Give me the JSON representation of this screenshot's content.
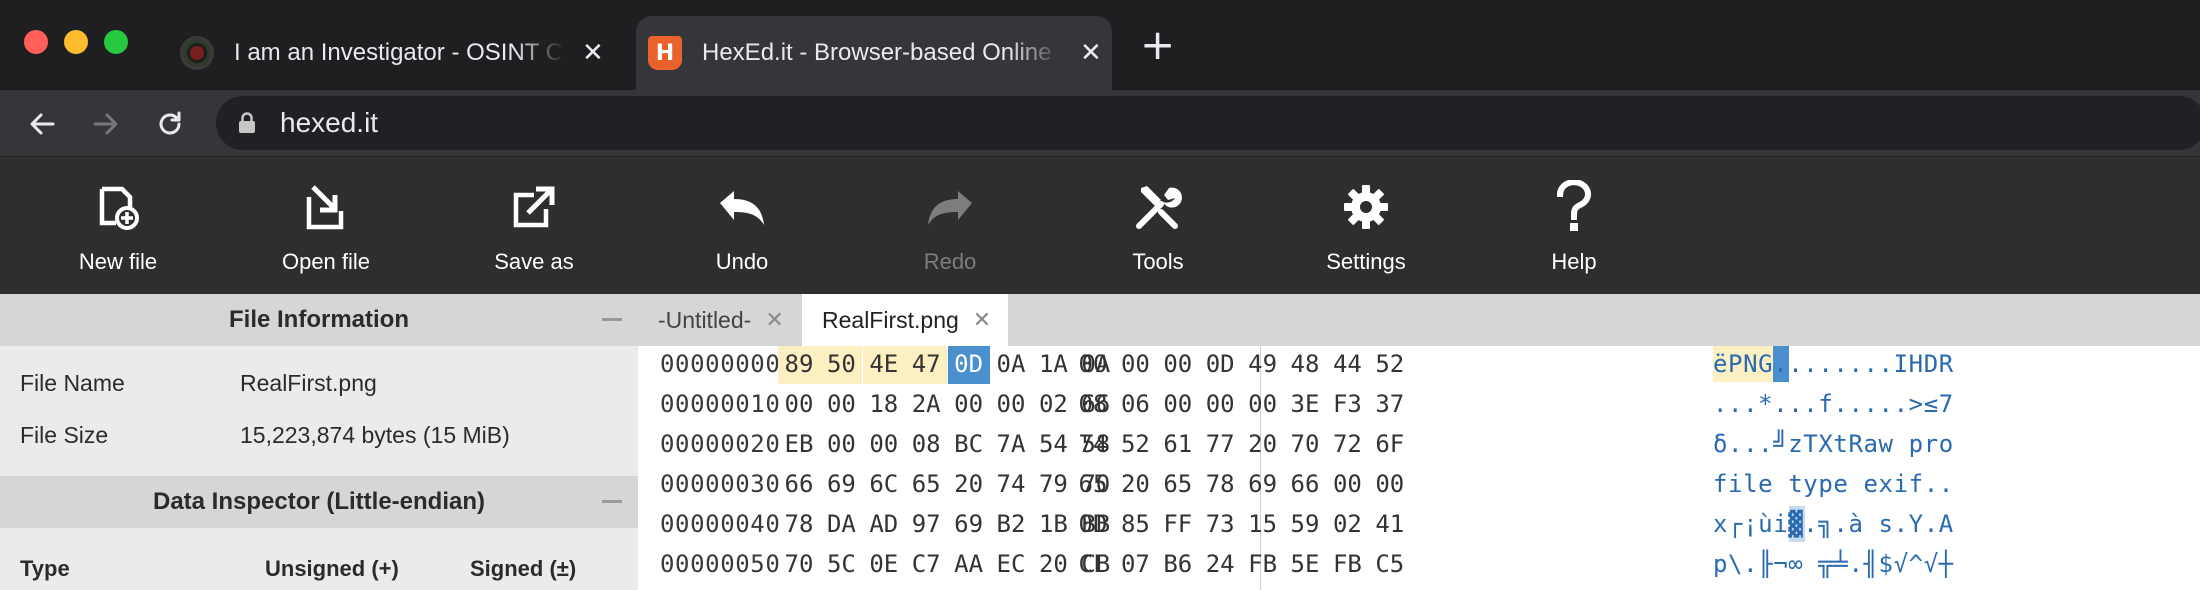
{
  "browser": {
    "tabs": [
      {
        "title": "I am an Investigator - OSINT Ch",
        "active": false
      },
      {
        "title": "HexEd.it - Browser-based Online",
        "active": true
      }
    ],
    "close_glyph": "✕",
    "new_tab_glyph": "+",
    "url": "hexed.it"
  },
  "toolbar": {
    "items": [
      {
        "label": "New file",
        "icon": "new-file-icon",
        "enabled": true
      },
      {
        "label": "Open file",
        "icon": "open-file-icon",
        "enabled": true
      },
      {
        "label": "Save as",
        "icon": "save-as-icon",
        "enabled": true
      },
      {
        "label": "Undo",
        "icon": "undo-icon",
        "enabled": true
      },
      {
        "label": "Redo",
        "icon": "redo-icon",
        "enabled": false
      },
      {
        "label": "Tools",
        "icon": "tools-icon",
        "enabled": true
      },
      {
        "label": "Settings",
        "icon": "gear-icon",
        "enabled": true
      },
      {
        "label": "Help",
        "icon": "help-icon",
        "enabled": true
      }
    ]
  },
  "file_info": {
    "title": "File Information",
    "rows": [
      {
        "label": "File Name",
        "value": "RealFirst.png"
      },
      {
        "label": "File Size",
        "value": "15,223,874 bytes (15 MiB)"
      }
    ]
  },
  "data_inspector": {
    "title": "Data Inspector (Little-endian)",
    "columns": [
      "Type",
      "Unsigned (+)",
      "Signed (±)"
    ]
  },
  "editor": {
    "tabs": [
      {
        "label": "-Untitled-",
        "active": false
      },
      {
        "label": "RealFirst.png",
        "active": true
      }
    ],
    "close_glyph": "✕",
    "rows": [
      {
        "offset": "00000000",
        "bytes": [
          "89",
          "50",
          "4E",
          "47",
          "0D",
          "0A",
          "1A",
          "0A",
          "00",
          "00",
          "00",
          "0D",
          "49",
          "48",
          "44",
          "52"
        ],
        "ascii": "ëPNG........IHDR"
      },
      {
        "offset": "00000010",
        "bytes": [
          "00",
          "00",
          "18",
          "2A",
          "00",
          "00",
          "02",
          "66",
          "08",
          "06",
          "00",
          "00",
          "00",
          "3E",
          "F3",
          "37"
        ],
        "ascii": "...*...f.....>≤7"
      },
      {
        "offset": "00000020",
        "bytes": [
          "EB",
          "00",
          "00",
          "08",
          "BC",
          "7A",
          "54",
          "58",
          "74",
          "52",
          "61",
          "77",
          "20",
          "70",
          "72",
          "6F"
        ],
        "ascii": "δ...╝zTXtRaw pro"
      },
      {
        "offset": "00000030",
        "bytes": [
          "66",
          "69",
          "6C",
          "65",
          "20",
          "74",
          "79",
          "70",
          "65",
          "20",
          "65",
          "78",
          "69",
          "66",
          "00",
          "00"
        ],
        "ascii": "file type exif.."
      },
      {
        "offset": "00000040",
        "bytes": [
          "78",
          "DA",
          "AD",
          "97",
          "69",
          "B2",
          "1B",
          "BB",
          "0D",
          "85",
          "FF",
          "73",
          "15",
          "59",
          "02",
          "41"
        ],
        "ascii": "x┌¡ùi▓.╗.à s.Y.A"
      },
      {
        "offset": "00000050",
        "bytes": [
          "70",
          "5C",
          "0E",
          "C7",
          "AA",
          "EC",
          "20",
          "CB",
          "CF",
          "07",
          "B6",
          "24",
          "FB",
          "5E",
          "FB",
          "C5"
        ],
        "ascii": "p\\.╟¬∞ ╦╧.╢$√^√┼"
      }
    ],
    "signature_bytes": 4,
    "selected_byte_index": 4
  },
  "colors": {
    "signature_highlight": "#fcefc2",
    "selection": "#4a8fce",
    "ascii_text": "#2a6ab0"
  }
}
